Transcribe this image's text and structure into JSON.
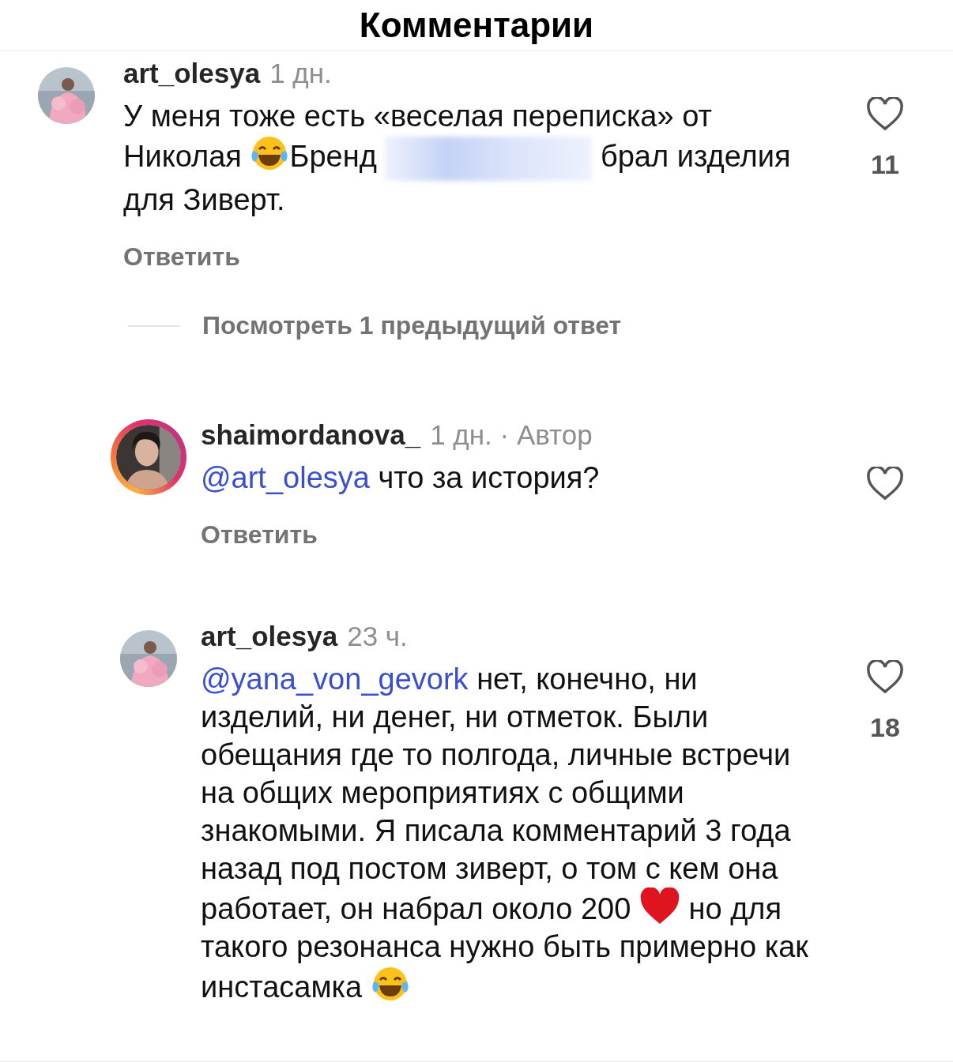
{
  "header": {
    "title": "Комментарии"
  },
  "comments": [
    {
      "username": "art_olesya",
      "time": "1 дн.",
      "story_ring": false,
      "reply_level": false,
      "likes": "11",
      "reply_label": "Ответить",
      "body": [
        {
          "kind": "text",
          "text": "У меня тоже есть «веселая переписка» от Николая "
        },
        {
          "kind": "laugh"
        },
        {
          "kind": "text",
          "text": "Бренд "
        },
        {
          "kind": "redacted"
        },
        {
          "kind": "text",
          "text": " брал изделия для Зиверт."
        }
      ]
    },
    {
      "kind": "more",
      "label": "Посмотреть 1 предыдущий ответ"
    },
    {
      "username": "shaimordanova_",
      "time": "1 дн. · Автор",
      "story_ring": true,
      "reply_level": true,
      "reply_label": "Ответить",
      "body": [
        {
          "kind": "mention",
          "text": "@art_olesya"
        },
        {
          "kind": "text",
          "text": " что за история?"
        }
      ]
    },
    {
      "username": "art_olesya",
      "time": "23 ч.",
      "story_ring": false,
      "reply_level": true,
      "likes": "18",
      "body": [
        {
          "kind": "mention",
          "text": "@yana_von_gevork"
        },
        {
          "kind": "text",
          "text": " нет, конечно, ни изделий, ни денег, ни отметок. Были обещания где то полгода, личные встречи на общих мероприятиях с общими знакомыми. Я писала комментарий 3 года назад под постом зиверт, о том с кем она работает, он набрал около 200 "
        },
        {
          "kind": "heart"
        },
        {
          "kind": "text",
          "text": " но для такого резонанса нужно быть примерно как инстасамка "
        },
        {
          "kind": "laugh"
        }
      ]
    }
  ]
}
